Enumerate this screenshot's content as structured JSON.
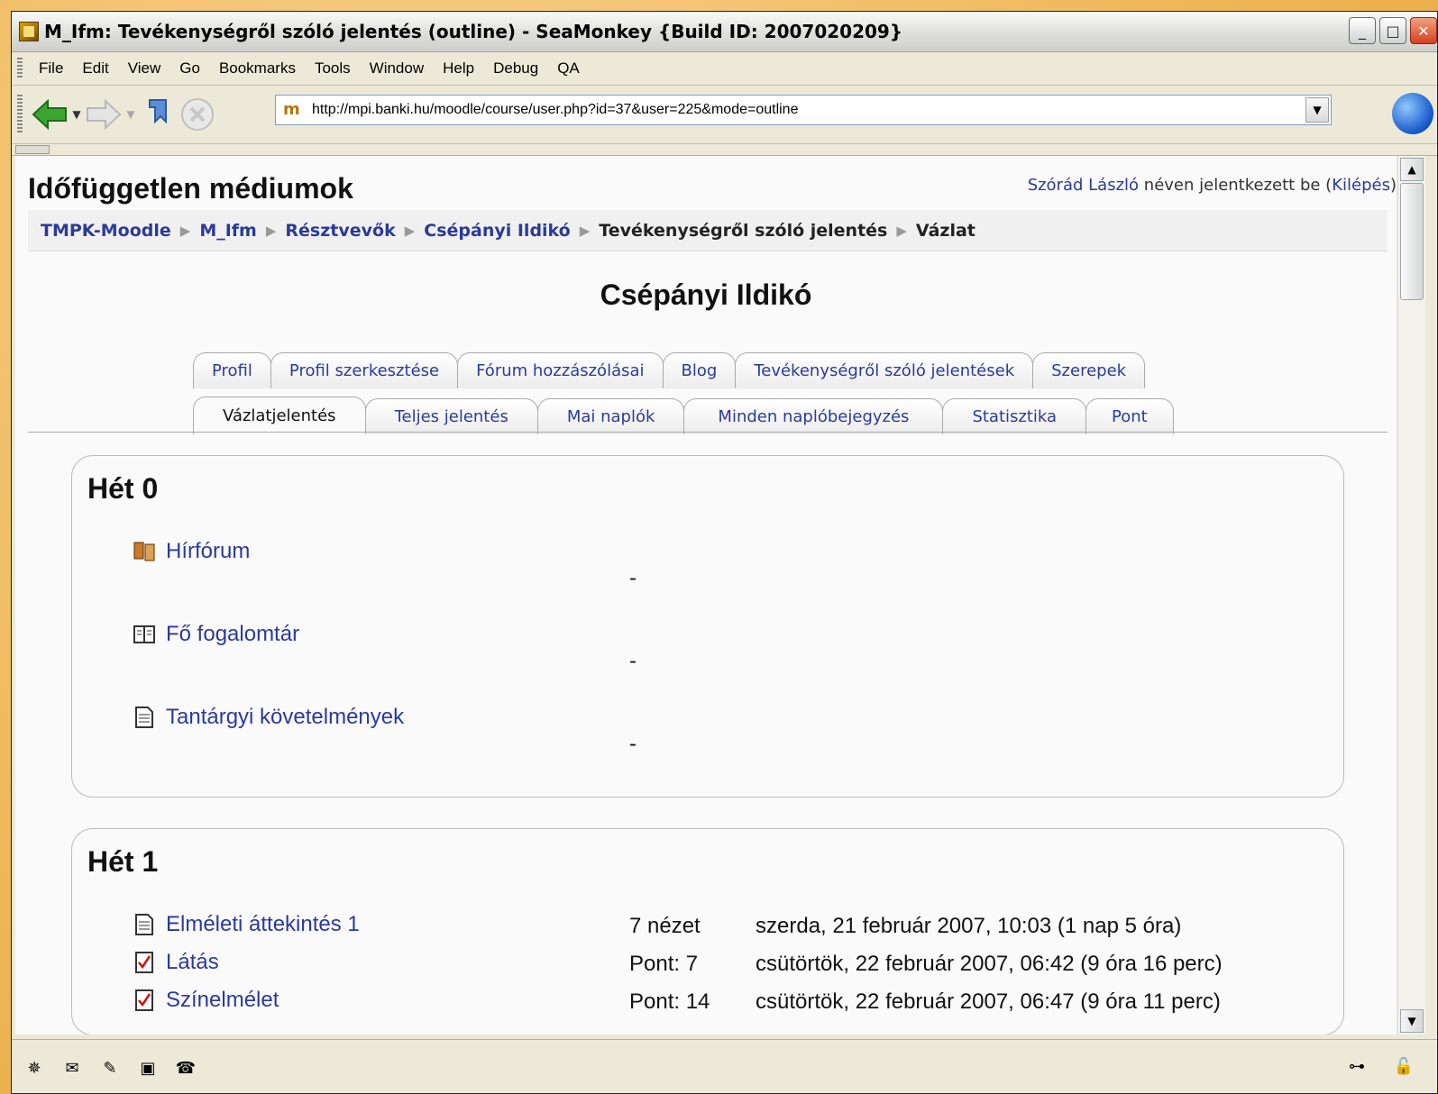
{
  "window": {
    "title": "M_Ifm: Tevékenységről szóló jelentés (outline) - SeaMonkey {Build ID: 2007020209}"
  },
  "menu": [
    "File",
    "Edit",
    "View",
    "Go",
    "Bookmarks",
    "Tools",
    "Window",
    "Help",
    "Debug",
    "QA"
  ],
  "nav": {
    "url": "http://mpi.banki.hu/moodle/course/user.php?id=37&user=225&mode=outline"
  },
  "page": {
    "site_title": "Időfüggetlen médiumok",
    "login": {
      "user": "Szórád László",
      "text": " néven jelentkezett be (",
      "logout": "Kilépés",
      "close": ")"
    },
    "breadcrumb": [
      {
        "label": "TMPK-Moodle",
        "link": true
      },
      {
        "label": "M_Ifm",
        "link": true
      },
      {
        "label": "Résztvevők",
        "link": true
      },
      {
        "label": "Csépányi Ildikó",
        "link": true
      },
      {
        "label": "Tevékenységről szóló jelentés",
        "link": false
      },
      {
        "label": "Vázlat",
        "link": false
      }
    ],
    "heading": "Csépányi Ildikó",
    "tabs_row1": [
      "Profil",
      "Profil szerkesztése",
      "Fórum hozzászólásai",
      "Blog",
      "Tevékenységről szóló jelentések",
      "Szerepek"
    ],
    "tabs_row2": [
      "Vázlatjelentés",
      "Teljes jelentés",
      "Mai naplók",
      "Minden naplóbejegyzés",
      "Statisztika",
      "Pont"
    ],
    "active_tab_row2": "Vázlatjelentés",
    "sections": [
      {
        "title": "Hét 0",
        "activities": [
          {
            "icon": "forum-icon",
            "name": "Hírfórum",
            "info": "-",
            "date": ""
          },
          {
            "icon": "glossary-icon",
            "name": "Fő fogalomtár",
            "info": "-",
            "date": ""
          },
          {
            "icon": "page-icon",
            "name": "Tantárgyi követelmények",
            "info": "-",
            "date": ""
          }
        ]
      },
      {
        "title": "Hét 1",
        "activities": [
          {
            "icon": "page-icon",
            "name": "Elméleti áttekintés 1",
            "info": "7 nézet",
            "date": "szerda, 21 február 2007, 10:03 (1 nap 5 óra)"
          },
          {
            "icon": "quiz-icon",
            "name": "Látás",
            "info": "Pont: 7",
            "date": "csütörtök, 22 február 2007, 06:42 (9 óra 16 perc)"
          },
          {
            "icon": "quiz-icon",
            "name": "Színelmélet",
            "info": "Pont: 14",
            "date": "csütörtök, 22 február 2007, 06:47 (9 óra 11 perc)"
          }
        ]
      }
    ]
  }
}
